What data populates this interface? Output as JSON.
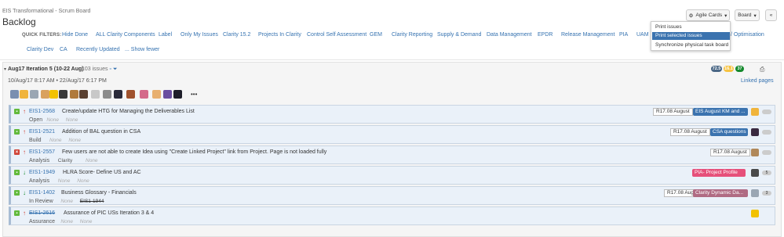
{
  "breadcrumb": "EIS Transformational - Scrum Board",
  "page_title": "Backlog",
  "quick_filters": {
    "label": "QUICK FILTERS:",
    "items": [
      "Hide Done",
      "ALL Clarity Components",
      "Label",
      "Only My Issues",
      "Clarity 15.2",
      "Projects In Clarity",
      "Control Self Assessment",
      "GEM",
      "Clarity Reporting",
      "Supply & Demand",
      "Data Management",
      "EPDR",
      "Release Management",
      "PIA",
      "UAM",
      "/ Optimisation",
      "Clarity Dev",
      "CA",
      "Recently Updated",
      "... Show fewer"
    ]
  },
  "toolbar": {
    "agile_cards_label": "Agile Cards",
    "board_label": "Board",
    "collapse_label": "«"
  },
  "agile_cards_menu": {
    "items": [
      "Print issues",
      "Print selected issues",
      "Synchronize physical task board"
    ],
    "selected_index": 1
  },
  "sprint": {
    "name": "Aug17 Iteration 5 (10-22 Aug)",
    "count": "103 issues",
    "dates": "10/Aug/17 8:17 AM  •  22/Aug/17 6:17 PM",
    "badges": [
      {
        "value": "72.5",
        "color": "#4a6785"
      },
      {
        "value": "16.1",
        "color": "#f6c342"
      },
      {
        "value": "37",
        "color": "#14892c"
      }
    ],
    "linked_pages": "Linked pages",
    "more_avatars": "•••"
  },
  "issues": [
    {
      "type": "story",
      "priority": "up",
      "key": "EIS1-2568",
      "summary": "Create/update HTG for Managing the Deliverables List",
      "status": "Open",
      "none1": "None",
      "none2": "None",
      "fix_version": "R17.08 August",
      "epic": "EIS August KM and ...",
      "epic_color": "#3b73af",
      "key_struck": false
    },
    {
      "type": "story",
      "priority": "up",
      "key": "EIS1-2521",
      "summary": "Addition of BAL question in CSA",
      "status": "Build",
      "none1": "None",
      "none2": "None",
      "fix_version": "R17.08 August",
      "epic": "CSA questions",
      "epic_color": "#3b73af",
      "key_struck": false
    },
    {
      "type": "bug",
      "priority": "up",
      "key": "EIS1-2557",
      "summary": "Few users are not able to create Idea using \"Create Linked Project\" link from Project. Page is not loaded fully",
      "status": "Analysis",
      "none1": "Clarity",
      "none2": "None",
      "fix_version": "R17.08 August",
      "epic": "",
      "epic_color": "",
      "key_struck": false
    },
    {
      "type": "story",
      "priority": "down",
      "key": "EIS1-1949",
      "summary": "HLRA Score- Define US and AC",
      "status": "Analysis",
      "none1": "None",
      "none2": "None",
      "fix_version": "",
      "epic": "PIA- Project Profile",
      "epic_color": "#e6507a",
      "estimate": "5",
      "key_struck": false
    },
    {
      "type": "story",
      "priority": "down",
      "key": "EIS1-1402",
      "summary": "Business Glossary - Financials",
      "status": "In Review",
      "none1": "None",
      "none2": "EIS1-1944",
      "fix_version": "R17.08 August",
      "epic": "Clarity Dynamic Da...",
      "epic_color": "#b06b83",
      "estimate": "3",
      "key_struck": false
    },
    {
      "type": "story",
      "priority": "up",
      "key": "EIS1-2616",
      "summary": "Assurance of PIC USs Iteration 3 & 4",
      "status": "Assurance",
      "none1": "None",
      "none2": "None",
      "fix_version": "",
      "epic": "",
      "epic_color": "",
      "key_struck": true
    }
  ],
  "colors": {
    "link": "#3572b0",
    "story": "#63ba3c",
    "bug": "#d04437",
    "priority_up": "#d04437",
    "priority_down": "#14892c",
    "row_bg": "#eaf1f9"
  }
}
